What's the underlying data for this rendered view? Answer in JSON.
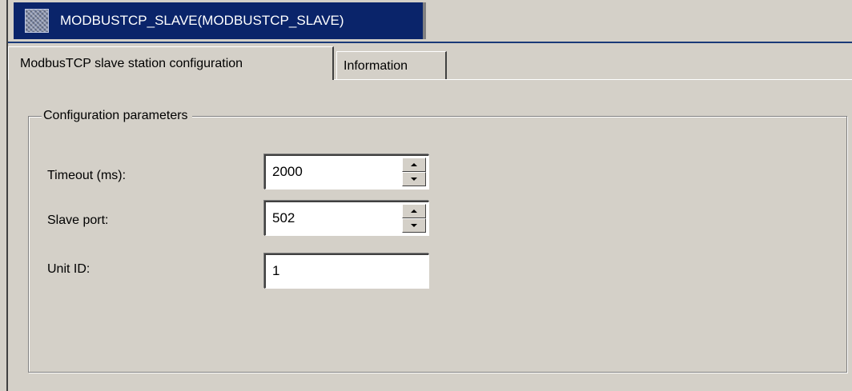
{
  "document_tab": {
    "title": "MODBUSTCP_SLAVE(MODBUSTCP_SLAVE)",
    "icon": "module-icon"
  },
  "tabs": [
    {
      "label": "ModbusTCP slave station configuration",
      "active": true
    },
    {
      "label": "Information",
      "active": false
    }
  ],
  "group": {
    "title": "Configuration parameters"
  },
  "fields": {
    "timeout": {
      "label": "Timeout (ms):",
      "value": "2000"
    },
    "slave_port": {
      "label": "Slave port:",
      "value": "502"
    },
    "unit_id": {
      "label": "Unit ID:",
      "value": "1"
    }
  },
  "colors": {
    "background": "#d4d0c8",
    "active_tab": "#0a246a",
    "active_tab_text": "#ffffff"
  }
}
